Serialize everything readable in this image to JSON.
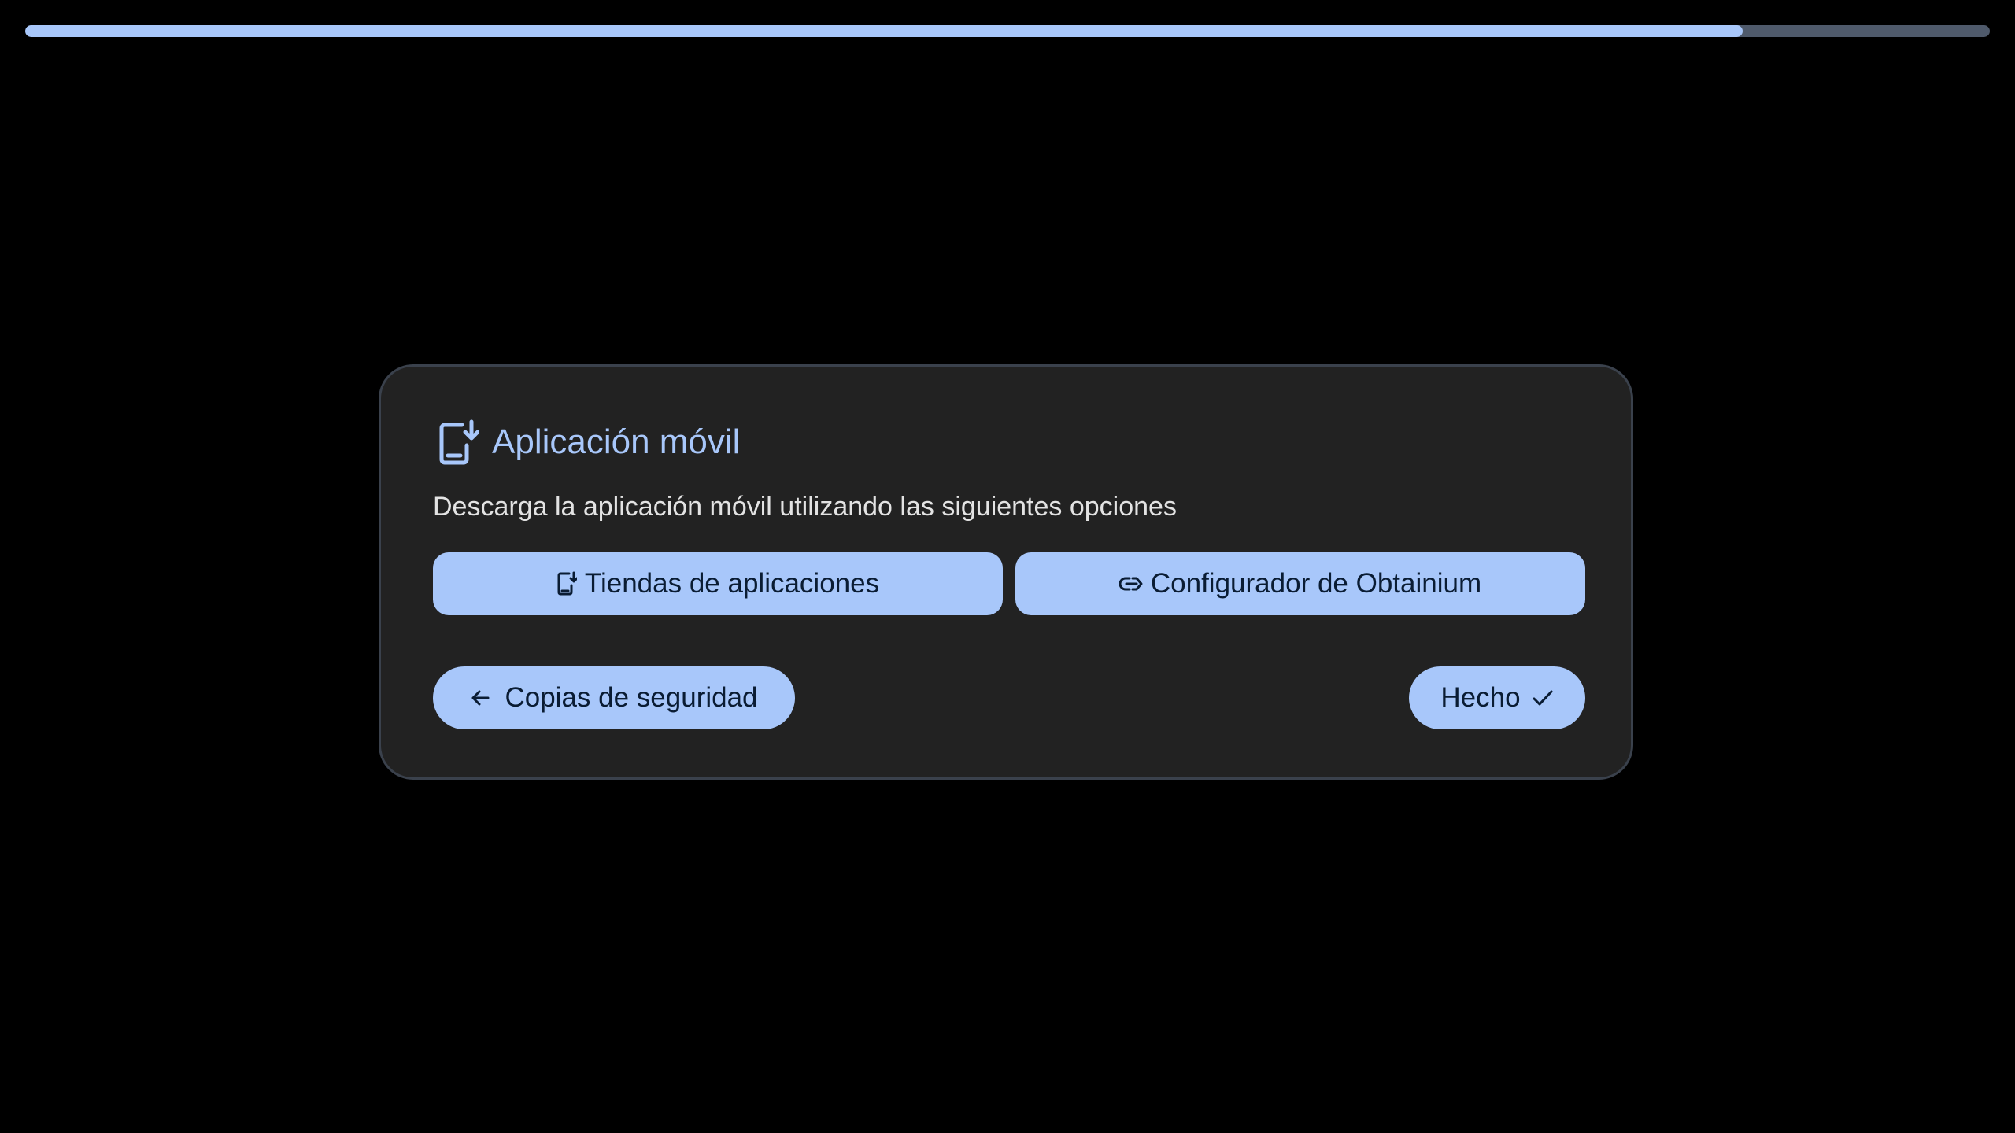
{
  "progress": {
    "value": 0.874,
    "track_color": "#4f5a6b",
    "fill_color": "#a8c7fa"
  },
  "dialog": {
    "icon": "phone-download-icon",
    "title": "Aplicación móvil",
    "description": "Descarga la aplicación móvil utilizando las siguientes opciones",
    "actions": {
      "app_stores": {
        "label": "Tiendas de aplicaciones",
        "icon": "phone-download-icon"
      },
      "obtainium": {
        "label": "Configurador de Obtainium",
        "icon": "link-arrow-icon"
      }
    },
    "nav": {
      "back": {
        "label": "Copias de seguridad",
        "icon": "arrow-back-icon"
      },
      "done": {
        "label": "Hecho",
        "icon": "check-icon"
      }
    }
  },
  "colors": {
    "background": "#000000",
    "card": "#222222",
    "accent": "#a8c7fa",
    "on_accent": "#0a1c33",
    "text": "#e3e3e3"
  }
}
